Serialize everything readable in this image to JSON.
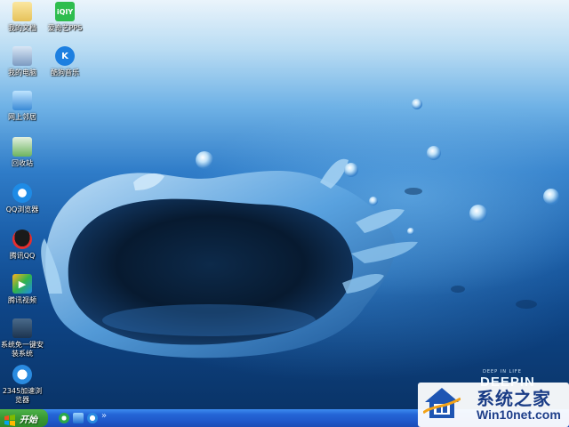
{
  "desktop_icons": [
    {
      "label": "我的文档",
      "icon": "folder-icon",
      "name": "desktop-icon-my-documents"
    },
    {
      "label": "爱奇艺PPS",
      "icon": "iqiyi-icon",
      "name": "desktop-icon-iqiyi-pps"
    },
    {
      "label": "我的电脑",
      "icon": "computer-icon",
      "name": "desktop-icon-my-computer"
    },
    {
      "label": "酷狗音乐",
      "icon": "kugou-icon",
      "name": "desktop-icon-kugou-music"
    },
    {
      "label": "网上邻居",
      "icon": "network-icon",
      "name": "desktop-icon-network"
    },
    {
      "label": "回收站",
      "icon": "recycle-bin-icon",
      "name": "desktop-icon-recycle-bin"
    },
    {
      "label": "QQ浏览器",
      "icon": "qq-browser-icon",
      "name": "desktop-icon-qq-browser"
    },
    {
      "label": "腾讯QQ",
      "icon": "qq-penguin-icon",
      "name": "desktop-icon-tencent-qq"
    },
    {
      "label": "腾讯视频",
      "icon": "tencent-video-icon",
      "name": "desktop-icon-tencent-video"
    },
    {
      "label": "系统免一键安装系统",
      "icon": "installer-icon",
      "name": "desktop-icon-system-installer"
    },
    {
      "label": "2345加速浏览器",
      "icon": "ie-browser-icon",
      "name": "desktop-icon-2345-browser"
    }
  ],
  "wallpaper": {
    "brand_small": "DEEP IN LIFE",
    "brand_big": "DEEPIN"
  },
  "watermark": {
    "title": "系统之家",
    "url": "Win10net.com"
  },
  "taskbar": {
    "start_label": "开始",
    "quick_launch": [
      "ie-icon",
      "media-player-icon",
      "browser-icon"
    ],
    "chevron": "»"
  },
  "colors": {
    "taskbar": "#2465d6",
    "start_button": "#3a9a35",
    "watermark_text": "#1a3c86"
  }
}
